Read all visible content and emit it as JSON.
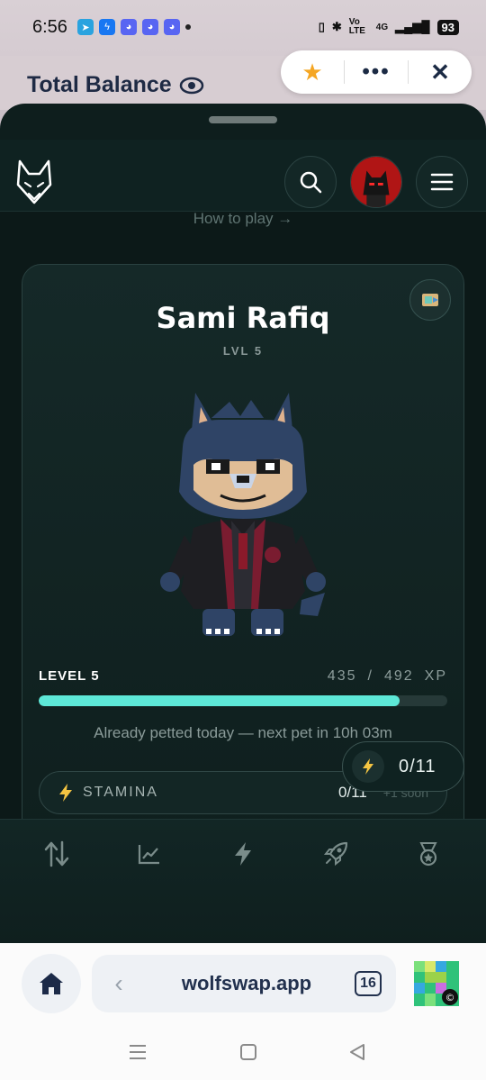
{
  "status_bar": {
    "time": "6:56",
    "battery": "93",
    "network": "4G",
    "volte": "Vo LTE"
  },
  "background_page": {
    "title": "Total Balance"
  },
  "browser_pill": {
    "star_icon": "star-icon",
    "more_icon": "more-icon",
    "close_icon": "close-icon"
  },
  "header": {
    "logo_icon": "wolf-logo-icon",
    "search_icon": "search-icon",
    "menu_icon": "hamburger-icon"
  },
  "main": {
    "how_to_play": "How to play →"
  },
  "pet_card": {
    "name": "Sami Rafiq",
    "level_tag": "LVL 5",
    "level_label": "LEVEL 5",
    "xp_current": "435",
    "xp_separator": "/",
    "xp_max": "492",
    "xp_unit": "XP",
    "xp_progress": 0.884,
    "pet_status": "Already petted today — next pet in 10h 03m",
    "stamina_label": "STAMINA",
    "stamina_value": "0/11",
    "stamina_soon": "+1 soon"
  },
  "floating_stamina": {
    "value": "0/11"
  },
  "bottom_nav": {
    "items": [
      "swap-icon",
      "chart-icon",
      "bolt-icon",
      "rocket-icon",
      "medal-icon"
    ]
  },
  "browser": {
    "url": "wolfswap.app",
    "tab_count": "16"
  },
  "colors": {
    "accent": "#5de8d7",
    "bolt": "#f5c542",
    "sheet_bg": "#0e1e1d"
  }
}
